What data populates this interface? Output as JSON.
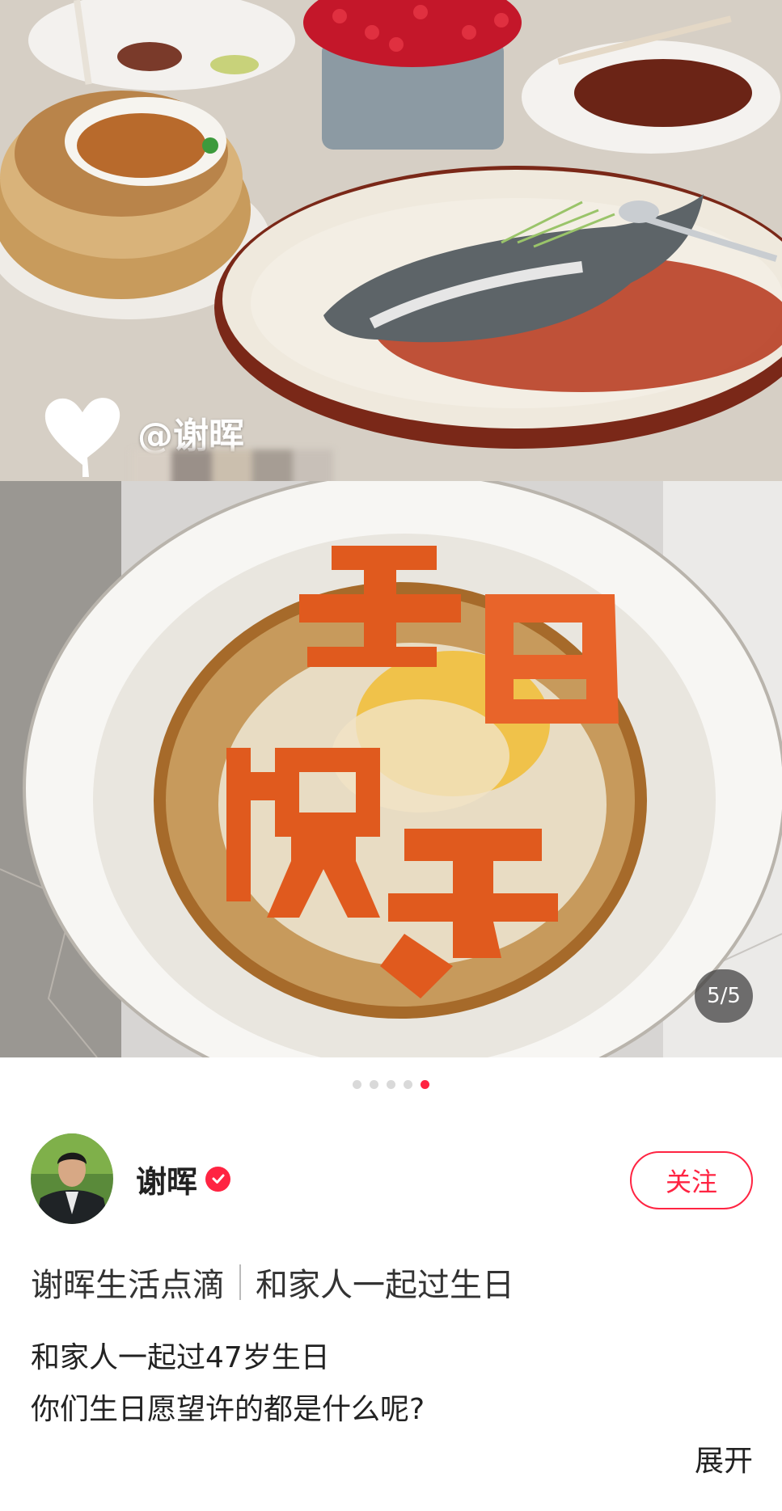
{
  "carousel": {
    "watermark_text": "@谢晖",
    "page_counter": "5/5",
    "total_pages": 5,
    "active_page": 5,
    "photos": [
      {
        "name": "banquet-table-photo"
      },
      {
        "name": "birthday-fried-egg-photo"
      }
    ]
  },
  "author": {
    "name": "谢晖",
    "verified": true,
    "follow_label": "关注"
  },
  "post": {
    "title_left": "谢晖生活点滴",
    "title_right": "和家人一起过生日",
    "body_lines": [
      "和家人一起过47岁生日",
      "你们生日愿望许的都是什么呢?"
    ],
    "expand_label": "展开"
  },
  "colors": {
    "accent": "#ff2442",
    "text_primary": "#222222",
    "dot_inactive": "#d9d9d9"
  },
  "icons": {
    "watermark": "heart-icon",
    "verified": "check-circle-icon"
  }
}
